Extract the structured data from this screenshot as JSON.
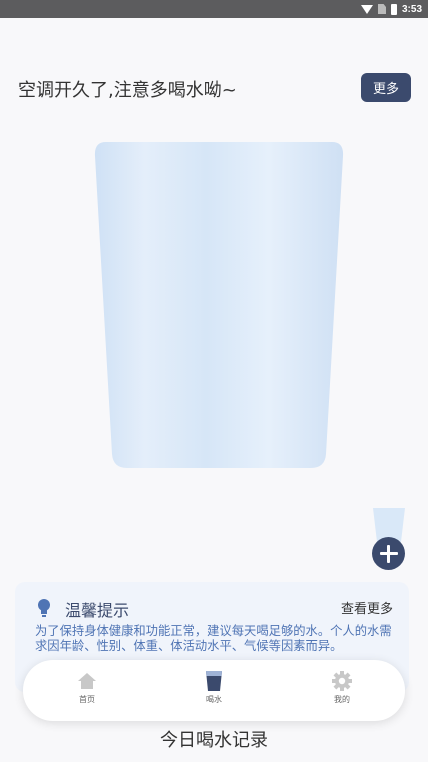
{
  "status_bar": {
    "time": "3:53",
    "icons": [
      "wifi-icon",
      "no-sim-icon",
      "battery-icon"
    ]
  },
  "header": {
    "tip": "空调开久了,注意多喝水呦~",
    "more_label": "更多"
  },
  "glass": {
    "fill_level": 0
  },
  "tip_card": {
    "title": "温馨提示",
    "more_label": "查看更多",
    "body": "为了保持身体健康和功能正常，建议每天喝足够的水。个人的水需求因年龄、性别、体重、体活动水平、气候等因素而异。"
  },
  "nav": {
    "items": [
      {
        "label": "首页",
        "icon": "home-icon"
      },
      {
        "label": "喝水",
        "icon": "water-cup-icon"
      },
      {
        "label": "我的",
        "icon": "gear-icon"
      }
    ]
  },
  "records": {
    "title": "今日喝水记录"
  },
  "colors": {
    "accent": "#3b4a6d",
    "tip_text": "#4f74b4",
    "glass": "#dce9f8"
  }
}
